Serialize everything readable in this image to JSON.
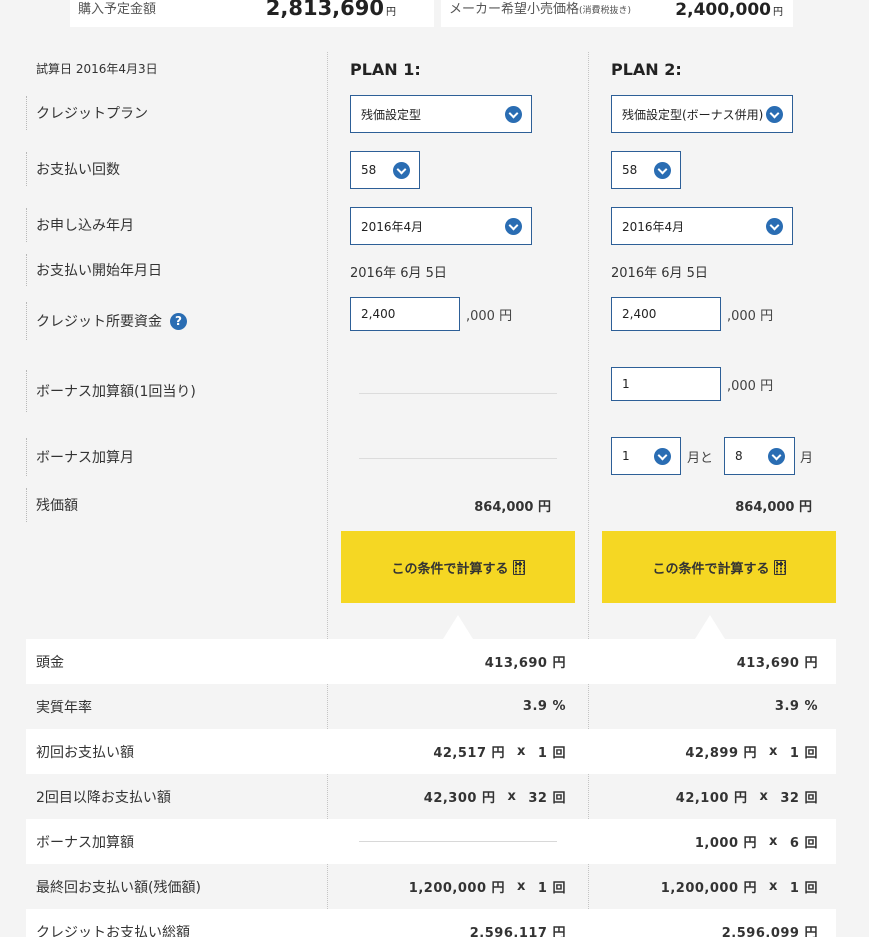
{
  "top": {
    "purchase_label": "購入予定金額",
    "purchase_value": "2,813,690",
    "purchase_unit": "円",
    "msrp_label": "メーカー希望小売価格",
    "msrp_note": "(消費税抜き)",
    "msrp_value": "2,400,000",
    "msrp_unit": "円"
  },
  "calc_date": "試算日 2016年4月3日",
  "labels": {
    "credit_plan": "クレジットプラン",
    "payment_count": "お支払い回数",
    "apply_month": "お申し込み年月",
    "start_date": "お支払い開始年月日",
    "required_fund": "クレジット所要資金",
    "bonus_amount": "ボーナス加算額(1回当り)",
    "bonus_month": "ボーナス加算月",
    "residual": "残価額"
  },
  "help_icon": "question-icon",
  "plans": [
    {
      "title": "PLAN 1:",
      "credit_plan": "残価設定型",
      "payment_count": "58",
      "apply_month": "2016年4月",
      "start_date": "2016年 6月 5日",
      "required_fund": "2,400",
      "required_fund_suffix": ",000 円",
      "residual": "864,000 円",
      "button": "この条件で計算する"
    },
    {
      "title": "PLAN 2:",
      "credit_plan": "残価設定型(ボーナス併用)",
      "payment_count": "58",
      "apply_month": "2016年4月",
      "start_date": "2016年 6月 5日",
      "required_fund": "2,400",
      "required_fund_suffix": ",000 円",
      "bonus_amount": "1",
      "bonus_amount_suffix": ",000 円",
      "bonus_month_1": "1",
      "bonus_month_and": "月と",
      "bonus_month_2": "8",
      "bonus_month_unit": "月",
      "residual": "864,000 円",
      "button": "この条件で計算する"
    }
  ],
  "results": {
    "rows": [
      {
        "label": "頭金",
        "p1": "413,690 円",
        "p2": "413,690 円"
      },
      {
        "label": "実質年率",
        "p1": "3.9 %",
        "p2": "3.9 %"
      },
      {
        "label": "初回お支払い額",
        "p1": "42,517 円",
        "p1_times": "1 回",
        "p2": "42,899 円",
        "p2_times": "1 回"
      },
      {
        "label": "2回目以降お支払い額",
        "p1": "42,300 円",
        "p1_times": "32 回",
        "p2": "42,100 円",
        "p2_times": "32 回"
      },
      {
        "label": "ボーナス加算額",
        "p2": "1,000 円",
        "p2_times": "6 回"
      },
      {
        "label": "最終回お支払い額(残価額)",
        "p1": "1,200,000 円",
        "p1_times": "1 回",
        "p2": "1,200,000 円",
        "p2_times": "1 回"
      },
      {
        "label": "クレジットお支払い総額",
        "p1": "2,596,117 円",
        "p2": "2,596,099 円"
      }
    ],
    "times_sign": "x"
  },
  "colors": {
    "accent": "#2a6db3",
    "button": "#f5d723",
    "background": "#f4f4f4"
  }
}
